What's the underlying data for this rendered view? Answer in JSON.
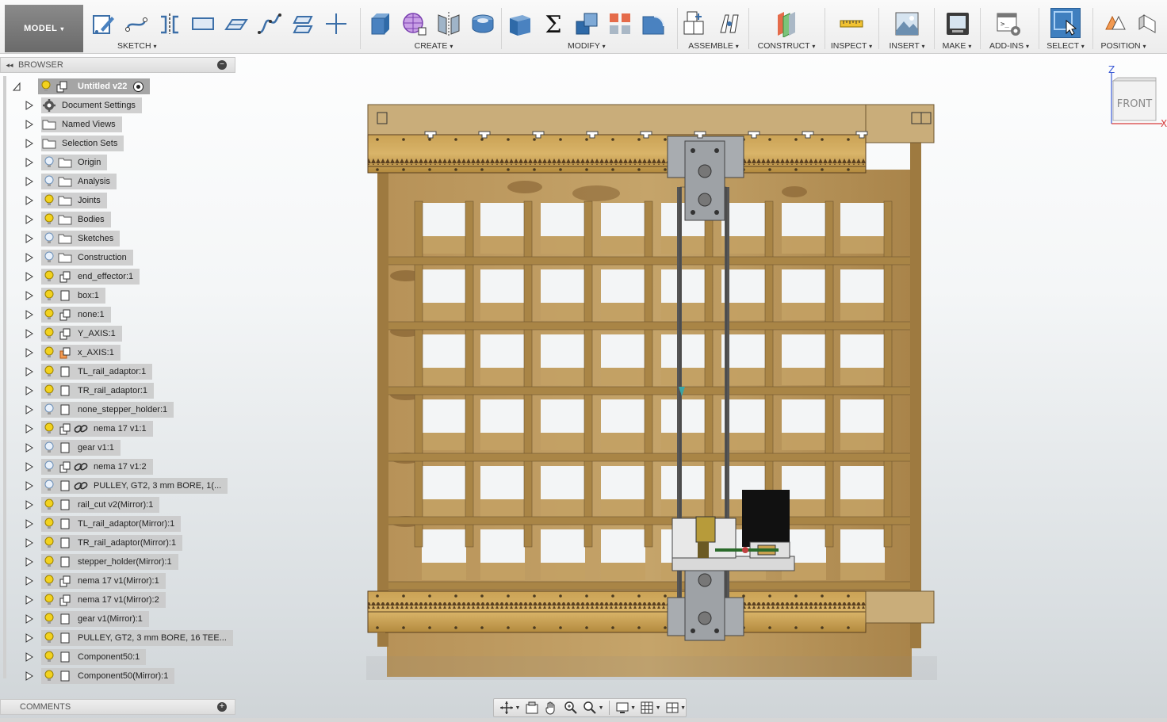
{
  "toolbar": {
    "workspace": "MODEL",
    "groups": [
      {
        "label": "SKETCH",
        "icons": [
          "create-sketch-icon",
          "line-icon",
          "mirror-sketch-icon",
          "rectangle-icon",
          "plane-sketch-icon",
          "spline-icon",
          "offset-plane-icon",
          "point-icon"
        ]
      },
      {
        "label": "CREATE",
        "icons": [
          "box-icon",
          "mesh-icon",
          "form-mirror-icon",
          "cylinder-icon"
        ]
      },
      {
        "label": "MODIFY",
        "icons": [
          "press-pull-icon",
          "sum-icon",
          "combine-icon",
          "pattern-icon",
          "fillet-icon"
        ]
      },
      {
        "label": "ASSEMBLE",
        "icons": [
          "new-component-icon",
          "joint-icon"
        ]
      },
      {
        "label": "CONSTRUCT",
        "icons": [
          "midplane-icon"
        ]
      },
      {
        "label": "INSPECT",
        "icons": [
          "measure-icon"
        ]
      },
      {
        "label": "INSERT",
        "icons": [
          "insert-image-icon"
        ]
      },
      {
        "label": "MAKE",
        "icons": [
          "print-3d-icon"
        ]
      },
      {
        "label": "ADD-INS",
        "icons": [
          "scripts-icon"
        ]
      },
      {
        "label": "SELECT",
        "icons": [
          "select-icon"
        ]
      },
      {
        "label": "POSITION",
        "icons": [
          "capture-position-icon",
          "position-icon"
        ]
      }
    ],
    "dropdown_glyph": "▾"
  },
  "browser": {
    "title": "BROWSER",
    "collapse_glyph": "◂◂",
    "minimize_glyph": "−",
    "root": "Untitled v22",
    "items": [
      {
        "label": "Document Settings",
        "type": "settings"
      },
      {
        "label": "Named Views",
        "type": "folder"
      },
      {
        "label": "Selection Sets",
        "type": "folder"
      },
      {
        "label": "Origin",
        "type": "folder",
        "bulb": "off"
      },
      {
        "label": "Analysis",
        "type": "folder",
        "bulb": "off"
      },
      {
        "label": "Joints",
        "type": "folder",
        "bulb": "on"
      },
      {
        "label": "Bodies",
        "type": "folder",
        "bulb": "on"
      },
      {
        "label": "Sketches",
        "type": "folder",
        "bulb": "off"
      },
      {
        "label": "Construction",
        "type": "folder",
        "bulb": "off"
      },
      {
        "label": "end_effector:1",
        "type": "assembly",
        "bulb": "on"
      },
      {
        "label": "box:1",
        "type": "component",
        "bulb": "on"
      },
      {
        "label": "none:1",
        "type": "assembly",
        "bulb": "on"
      },
      {
        "label": "Y_AXIS:1",
        "type": "assembly",
        "bulb": "on"
      },
      {
        "label": "x_AXIS:1",
        "type": "assembly-active",
        "bulb": "on"
      },
      {
        "label": "TL_rail_adaptor:1",
        "type": "component",
        "bulb": "on"
      },
      {
        "label": "TR_rail_adaptor:1",
        "type": "component",
        "bulb": "on"
      },
      {
        "label": "none_stepper_holder:1",
        "type": "component",
        "bulb": "off"
      },
      {
        "label": "nema 17 v1:1",
        "type": "linked",
        "bulb": "on"
      },
      {
        "label": "gear v1:1",
        "type": "component",
        "bulb": "off"
      },
      {
        "label": "nema 17 v1:2",
        "type": "linked",
        "bulb": "off"
      },
      {
        "label": "PULLEY, GT2, 3 mm BORE,  1(...",
        "type": "linked-single",
        "bulb": "off"
      },
      {
        "label": "rail_cut v2(Mirror):1",
        "type": "component",
        "bulb": "on"
      },
      {
        "label": "TL_rail_adaptor(Mirror):1",
        "type": "component",
        "bulb": "on"
      },
      {
        "label": "TR_rail_adaptor(Mirror):1",
        "type": "component",
        "bulb": "on"
      },
      {
        "label": "stepper_holder(Mirror):1",
        "type": "component",
        "bulb": "on"
      },
      {
        "label": "nema 17 v1(Mirror):1",
        "type": "assembly",
        "bulb": "on"
      },
      {
        "label": "nema 17 v1(Mirror):2",
        "type": "assembly",
        "bulb": "on"
      },
      {
        "label": "gear v1(Mirror):1",
        "type": "component",
        "bulb": "on"
      },
      {
        "label": "PULLEY, GT2, 3 mm BORE,  16 TEE...",
        "type": "component",
        "bulb": "on"
      },
      {
        "label": "Component50:1",
        "type": "component",
        "bulb": "on"
      },
      {
        "label": "Component50(Mirror):1",
        "type": "component",
        "bulb": "on"
      }
    ]
  },
  "comments": {
    "title": "COMMENTS",
    "add_glyph": "+"
  },
  "viewcube": {
    "face": "FRONT",
    "axis_z": "Z",
    "axis_x": "X"
  },
  "navbar": {
    "tools": [
      "orbit-icon",
      "look-at-icon",
      "pan-icon",
      "zoom-icon",
      "fit-icon",
      "display-settings-icon",
      "grid-icon",
      "viewports-icon"
    ]
  },
  "colors": {
    "wood": "#b08a4e",
    "wood_dark": "#7d5a2c",
    "rail": "#c79a4a",
    "metal": "#9ea2a6",
    "select_blue": "#3f7fbf"
  }
}
